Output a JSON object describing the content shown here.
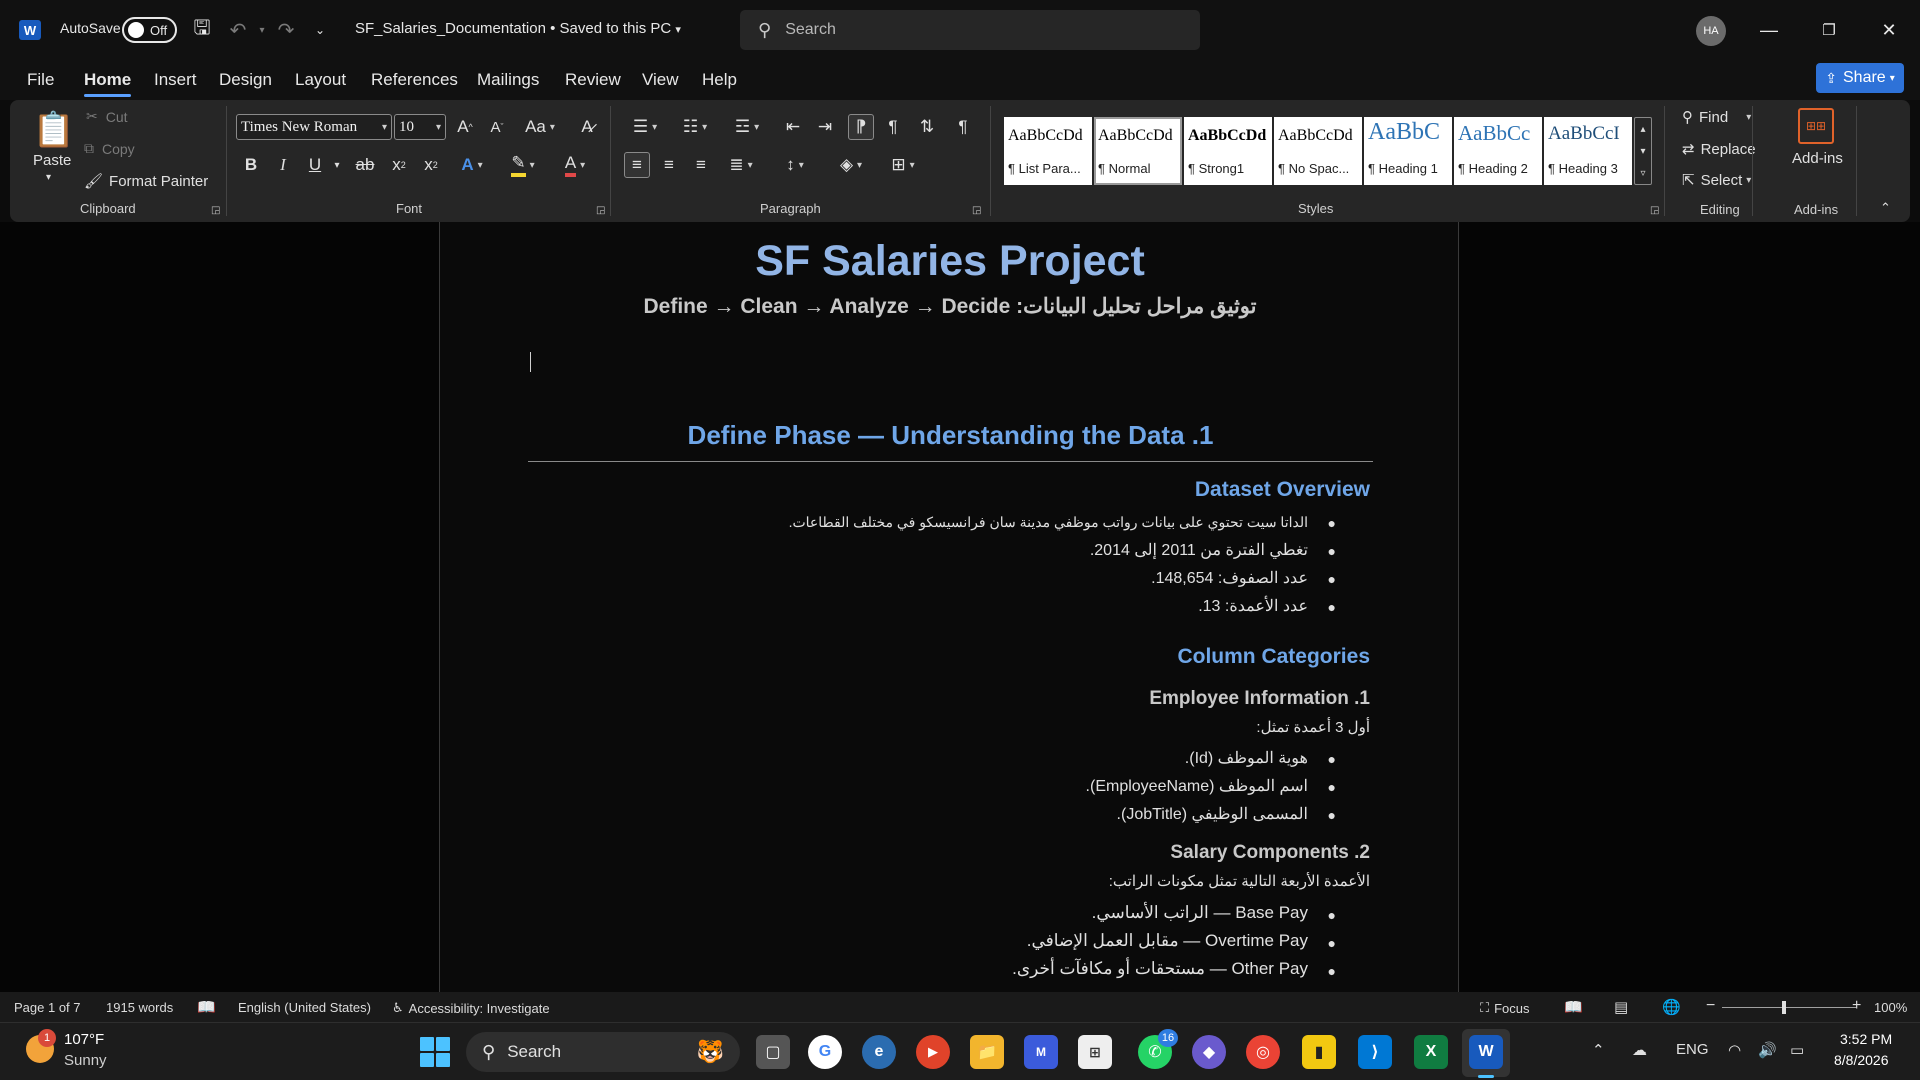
{
  "titlebar": {
    "app_icon": "word-icon",
    "autosave_label": "AutoSave",
    "autosave_state": "Off",
    "doc_title": "SF_Salaries_Documentation • Saved to this PC",
    "search_placeholder": "Search",
    "avatar_initials": "HA"
  },
  "menu": {
    "items": [
      "File",
      "Home",
      "Insert",
      "Design",
      "Layout",
      "References",
      "Mailings",
      "Review",
      "View",
      "Help"
    ],
    "active": "Home",
    "share_label": "Share"
  },
  "ribbon": {
    "clipboard": {
      "label": "Clipboard",
      "paste": "Paste",
      "cut": "Cut",
      "copy": "Copy",
      "format_painter": "Format Painter"
    },
    "font": {
      "label": "Font",
      "font_name": "Times New Roman",
      "font_size": "10"
    },
    "paragraph": {
      "label": "Paragraph"
    },
    "styles": {
      "label": "Styles",
      "items": [
        {
          "sample": "AaBbCcDd",
          "name": "¶ List Para..."
        },
        {
          "sample": "AaBbCcDd",
          "name": "¶ Normal"
        },
        {
          "sample": "AaBbCcDd",
          "name": "¶ Strong1"
        },
        {
          "sample": "AaBbCcDd",
          "name": "¶ No Spac..."
        },
        {
          "sample": "AaBbC",
          "name": "¶ Heading 1"
        },
        {
          "sample": "AaBbCc",
          "name": "¶ Heading 2"
        },
        {
          "sample": "AaBbCcI",
          "name": "¶ Heading 3"
        }
      ]
    },
    "editing": {
      "label": "Editing",
      "find": "Find",
      "replace": "Replace",
      "select": "Select"
    },
    "addins": {
      "label": "Add-ins",
      "button": "Add-ins"
    }
  },
  "document": {
    "title": "SF Salaries Project",
    "subtitle": "توثيق مراحل تحليل البيانات: Define → Clean → Analyze → Decide",
    "h1": "1. Define Phase — Understanding the Data",
    "dataset_overview": {
      "heading": "Dataset Overview",
      "bullets": [
        "الداتا سيت تحتوي على بيانات رواتب موظفي مدينة سان فرانسيسكو في مختلف القطاعات.",
        "تغطي الفترة من 2011 إلى 2014.",
        "عدد الصفوف: 148,654.",
        "عدد الأعمدة: 13."
      ]
    },
    "column_categories": {
      "heading": "Column Categories",
      "employee_info": {
        "heading": "1. Employee Information",
        "intro": "أول 3 أعمدة تمثل:",
        "bullets": [
          "هوية الموظف (Id).",
          "اسم الموظف (EmployeeName).",
          "المسمى الوظيفي (JobTitle)."
        ]
      },
      "salary_components": {
        "heading": "2. Salary Components",
        "intro": "الأعمدة الأربعة التالية تمثل مكونات الراتب:",
        "bullets": [
          "Base Pay — الراتب الأساسي.",
          "Overtime Pay — مقابل العمل الإضافي.",
          "Other Pay — مستحقات أو مكافآت أخرى."
        ]
      }
    }
  },
  "status": {
    "page": "Page 1 of 7",
    "words": "1915 words",
    "language": "English (United States)",
    "accessibility": "Accessibility: Investigate",
    "focus": "Focus",
    "zoom": "100%"
  },
  "taskbar": {
    "weather_temp": "107°F",
    "weather_desc": "Sunny",
    "weather_badge": "1",
    "search": "Search",
    "whatsapp_badge": "16",
    "lang": "ENG",
    "time": "3:52 PM",
    "date": "8/8/2026"
  },
  "colors": {
    "accent": "#2e72d8",
    "heading": "#6fa6e8",
    "title": "#92b5e6"
  }
}
